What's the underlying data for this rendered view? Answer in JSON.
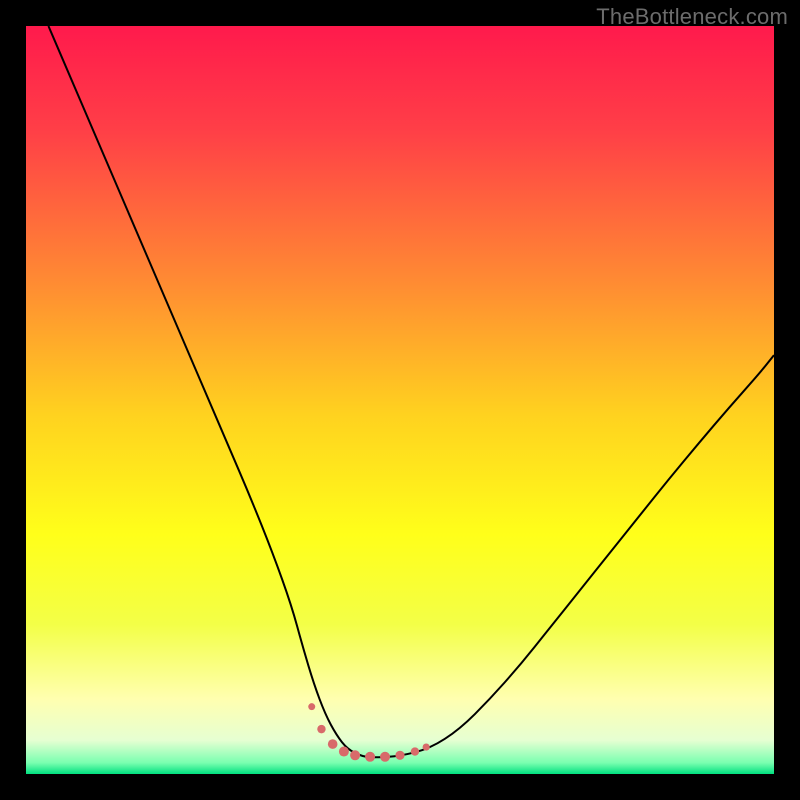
{
  "watermark": "TheBottleneck.com",
  "colors": {
    "frame": "#000000",
    "gradient_stops": [
      {
        "offset": 0.0,
        "color": "#ff1a4c"
      },
      {
        "offset": 0.14,
        "color": "#ff3f47"
      },
      {
        "offset": 0.34,
        "color": "#ff8a33"
      },
      {
        "offset": 0.52,
        "color": "#ffd21f"
      },
      {
        "offset": 0.68,
        "color": "#ffff1a"
      },
      {
        "offset": 0.8,
        "color": "#f3ff47"
      },
      {
        "offset": 0.9,
        "color": "#ffffb0"
      },
      {
        "offset": 0.955,
        "color": "#e6ffd2"
      },
      {
        "offset": 0.985,
        "color": "#7affb0"
      },
      {
        "offset": 1.0,
        "color": "#00e080"
      }
    ],
    "curve": "#000000",
    "markers": "#d86a6a"
  },
  "chart_data": {
    "type": "line",
    "title": "",
    "xlabel": "",
    "ylabel": "",
    "xlim": [
      0,
      100
    ],
    "ylim": [
      0,
      100
    ],
    "grid": false,
    "legend": false,
    "series": [
      {
        "name": "bottleneck-curve",
        "x": [
          3,
          6,
          9,
          12,
          15,
          18,
          21,
          24,
          27,
          30,
          33,
          35.5,
          37,
          38.5,
          40,
          41.5,
          43,
          45,
          47,
          50,
          54,
          58,
          62,
          66,
          70,
          74,
          78,
          82,
          86,
          90,
          94,
          98,
          100
        ],
        "y": [
          100,
          93,
          86,
          79,
          72,
          65,
          58,
          51,
          44,
          37,
          29.5,
          22.5,
          17,
          12,
          8,
          5.2,
          3.3,
          2.3,
          2.2,
          2.4,
          3.4,
          6,
          10,
          14.5,
          19.5,
          24.5,
          29.5,
          34.5,
          39.5,
          44.3,
          49,
          53.5,
          56
        ]
      }
    ],
    "markers": {
      "name": "valley-markers",
      "x": [
        38.2,
        39.5,
        41,
        42.5,
        44,
        46,
        48,
        50,
        52,
        53.5
      ],
      "y": [
        9,
        6,
        4,
        3,
        2.5,
        2.3,
        2.3,
        2.5,
        3,
        3.6
      ],
      "r": [
        3.5,
        4.2,
        4.8,
        5,
        5,
        5,
        5,
        4.6,
        4.2,
        3.6
      ]
    }
  }
}
